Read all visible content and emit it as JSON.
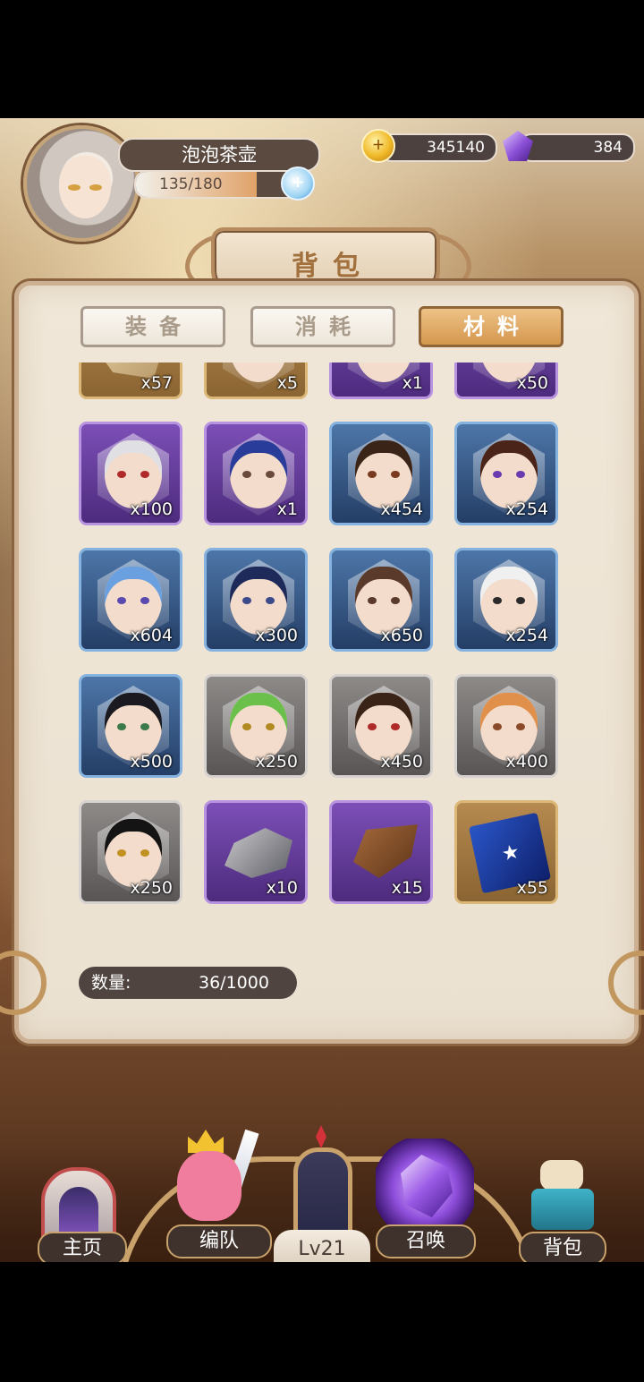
{
  "player": {
    "name": "泡泡茶壶",
    "stamina": "135/180",
    "stamina_fraction": 0.75,
    "stamina_plus": "+"
  },
  "currency": {
    "gold": "345140",
    "gems": "384"
  },
  "page_title": "背包",
  "tabs": [
    {
      "label": "装备",
      "active": false
    },
    {
      "label": "消耗",
      "active": false
    },
    {
      "label": "材料",
      "active": true
    }
  ],
  "items": [
    {
      "type": "paper",
      "frame": "gold",
      "qty": "x57"
    },
    {
      "type": "portrait",
      "frame": "gold",
      "qty": "x5",
      "hair": "#d8cfc4",
      "eye": "#4f8a6a"
    },
    {
      "type": "portrait",
      "frame": "purple",
      "qty": "x1",
      "hair": "#5a2a20",
      "eye": "#8a2a2a"
    },
    {
      "type": "portrait",
      "frame": "purple",
      "qty": "x50",
      "hair": "#e8e4e0",
      "eye": "#c06a20"
    },
    {
      "type": "portrait",
      "frame": "purple",
      "qty": "x100",
      "hair": "#e0e0e4",
      "eye": "#b02a2a"
    },
    {
      "type": "portrait",
      "frame": "purple",
      "qty": "x1",
      "hair": "#2a3c9a",
      "eye": "#6a4a3a"
    },
    {
      "type": "portrait",
      "frame": "blue",
      "qty": "x454",
      "hair": "#3a2418",
      "eye": "#7a3a20"
    },
    {
      "type": "portrait",
      "frame": "blue",
      "qty": "x254",
      "hair": "#4a2418",
      "eye": "#6a3ab0"
    },
    {
      "type": "portrait",
      "frame": "blue",
      "qty": "x604",
      "hair": "#6aa0e0",
      "eye": "#5a4ab0"
    },
    {
      "type": "portrait",
      "frame": "blue",
      "qty": "x300",
      "hair": "#1e2a5a",
      "eye": "#3a4a8a"
    },
    {
      "type": "portrait",
      "frame": "blue",
      "qty": "x650",
      "hair": "#5a3a2a",
      "eye": "#5a3a2a"
    },
    {
      "type": "portrait",
      "frame": "blue",
      "qty": "x254",
      "hair": "#f0f0f0",
      "eye": "#2a2a2a"
    },
    {
      "type": "portrait",
      "frame": "blue",
      "qty": "x500",
      "hair": "#1a1a20",
      "eye": "#3a7a4a"
    },
    {
      "type": "portrait",
      "frame": "gray",
      "qty": "x250",
      "hair": "#6ac04a",
      "eye": "#b08a20"
    },
    {
      "type": "portrait",
      "frame": "gray",
      "qty": "x450",
      "hair": "#3a2418",
      "eye": "#b02a2a"
    },
    {
      "type": "portrait",
      "frame": "gray",
      "qty": "x400",
      "hair": "#e0904a",
      "eye": "#8a4a2a"
    },
    {
      "type": "portrait",
      "frame": "gray",
      "qty": "x250",
      "hair": "#141414",
      "eye": "#c09020"
    },
    {
      "type": "stone",
      "frame": "purple",
      "qty": "x10"
    },
    {
      "type": "log",
      "frame": "purple",
      "qty": "x15"
    },
    {
      "type": "cards",
      "frame": "gold",
      "qty": "x55"
    }
  ],
  "inventory": {
    "count_label": "数量:",
    "count_value": "36/1000"
  },
  "nav": {
    "home": "主页",
    "team": "编队",
    "level": "Lv21",
    "summon": "召唤",
    "bag": "背包"
  }
}
